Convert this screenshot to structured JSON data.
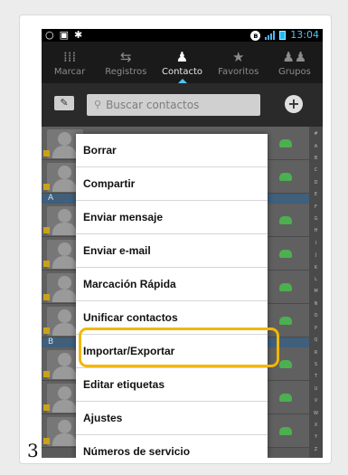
{
  "status_bar": {
    "time": "13:04",
    "icons": [
      "circle-outline-icon",
      "image-icon",
      "android-icon",
      "bluetooth-icon",
      "signal-icon",
      "battery-icon"
    ]
  },
  "tabs": [
    {
      "label": "Marcar",
      "icon": "dialpad-icon",
      "active": false
    },
    {
      "label": "Registros",
      "icon": "swap-arrows-icon",
      "active": false
    },
    {
      "label": "Contacto",
      "icon": "person-icon",
      "active": true
    },
    {
      "label": "Favoritos",
      "icon": "star-icon",
      "active": false
    },
    {
      "label": "Grupos",
      "icon": "group-icon",
      "active": false
    }
  ],
  "search": {
    "placeholder": "Buscar contactos"
  },
  "list": {
    "section_labels": [
      "A",
      "B"
    ]
  },
  "alpha_index": [
    "#",
    "A",
    "B",
    "C",
    "D",
    "E",
    "F",
    "G",
    "H",
    "I",
    "J",
    "K",
    "L",
    "M",
    "N",
    "O",
    "P",
    "Q",
    "R",
    "S",
    "T",
    "U",
    "V",
    "W",
    "X",
    "Y",
    "Z"
  ],
  "menu": {
    "items": [
      "Borrar",
      "Compartir",
      "Enviar mensaje",
      "Enviar e-mail",
      "Marcación Rápida",
      "Unificar contactos",
      "Importar/Exportar",
      "Editar etiquetas",
      "Ajustes",
      "Números de servicio"
    ],
    "highlighted": "Importar/Exportar"
  },
  "colors": {
    "highlight": "#f2b705",
    "accent": "#4fc3f7",
    "call_icon": "#4caf50"
  },
  "step_number": "3"
}
